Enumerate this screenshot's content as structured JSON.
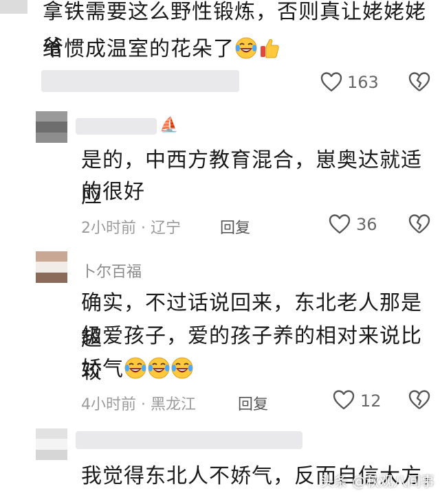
{
  "comment1": {
    "line1": "拿铁需要这么野性锻炼，否则真让姥姥姥爷",
    "line2": "给惯成温室的花朵了",
    "emoji": [
      "crying-laughing",
      "thumbs-up"
    ],
    "likes": "163"
  },
  "comment2": {
    "line1": "是的，中西方教育混合，崽奥达就适应",
    "line2": "的很好",
    "time_location": "2小时前 · 辽宁",
    "reply_label": "回复",
    "likes": "36"
  },
  "comment3": {
    "username": "卜尔百福",
    "line1": "确实，不过话说回来，东北老人那是超",
    "line2": "级爱孩子，爱的孩子养的相对来说比较",
    "line3": "娇气",
    "emoji": [
      "crying-laughing",
      "crying-laughing",
      "crying-laughing"
    ],
    "time_location": "4小时前 · 黑龙江",
    "reply_label": "回复",
    "likes": "12"
  },
  "comment4": {
    "line1": "我觉得东北人不娇气，反而自信大方，"
  },
  "watermark": "头条 @秋观八间事",
  "colors": {
    "like_icon": "#555555",
    "blur": "#e9e9ec"
  }
}
